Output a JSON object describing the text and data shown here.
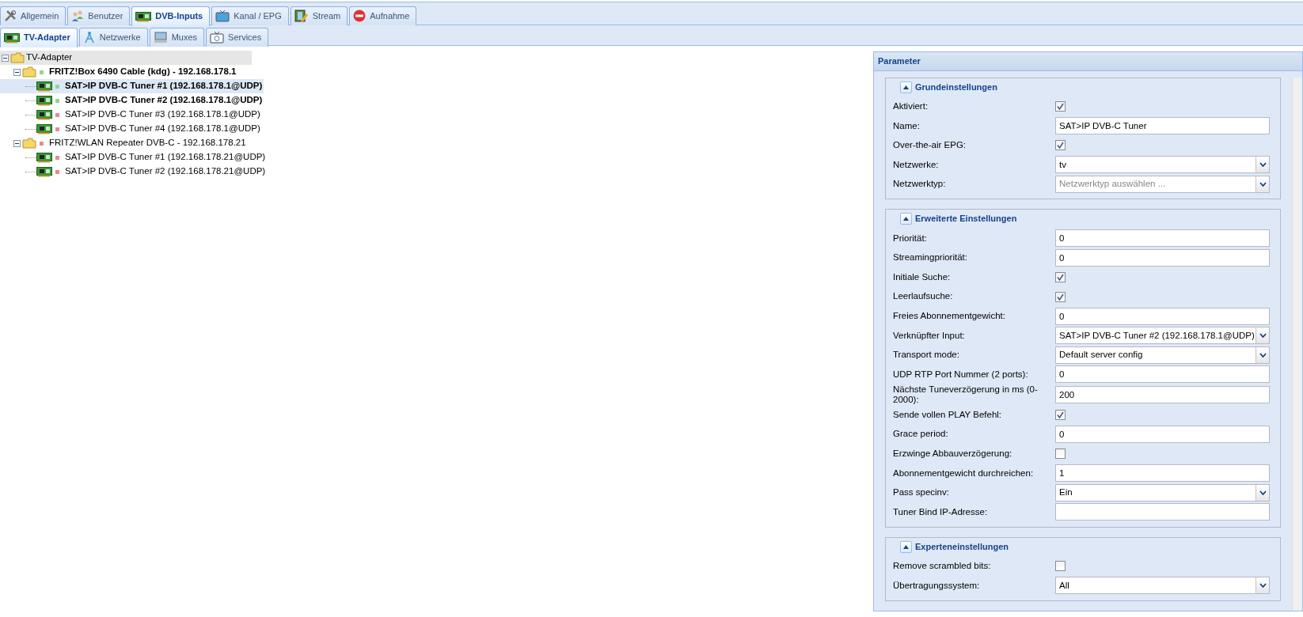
{
  "main_tabs": [
    {
      "label": "Allgemein",
      "selected": false
    },
    {
      "label": "Benutzer",
      "selected": false
    },
    {
      "label": "DVB-Inputs",
      "selected": true
    },
    {
      "label": "Kanal / EPG",
      "selected": false
    },
    {
      "label": "Stream",
      "selected": false
    },
    {
      "label": "Aufnahme",
      "selected": false
    }
  ],
  "sub_tabs": [
    {
      "label": "TV-Adapter",
      "selected": true
    },
    {
      "label": "Netzwerke",
      "selected": false
    },
    {
      "label": "Muxes",
      "selected": false
    },
    {
      "label": "Services",
      "selected": false
    }
  ],
  "tree": [
    {
      "label": "TV-Adapter",
      "kind": "folder",
      "expanded": true,
      "children": [
        {
          "label": "FRITZ!Box 6490 Cable (kdg) - 192.168.178.1",
          "kind": "folder",
          "expanded": true,
          "enabled": true,
          "color": "#8fd88f",
          "children": [
            {
              "label": "SAT>IP DVB-C Tuner #1 (192.168.178.1@UDP)",
              "kind": "tuner",
              "enabled": true,
              "color": "#8fd88f",
              "selected": true
            },
            {
              "label": "SAT>IP DVB-C Tuner #2 (192.168.178.1@UDP)",
              "kind": "tuner",
              "enabled": true,
              "color": "#8fd88f",
              "selected": false
            },
            {
              "label": "SAT>IP DVB-C Tuner #3 (192.168.178.1@UDP)",
              "kind": "tuner",
              "enabled": false,
              "color": "#e88a8a",
              "selected": false
            },
            {
              "label": "SAT>IP DVB-C Tuner #4 (192.168.178.1@UDP)",
              "kind": "tuner",
              "enabled": false,
              "color": "#e88a8a",
              "selected": false
            }
          ]
        },
        {
          "label": "FRITZ!WLAN Repeater DVB-C - 192.168.178.21",
          "kind": "folder",
          "expanded": true,
          "enabled": false,
          "color": "#e88a8a",
          "children": [
            {
              "label": "SAT>IP DVB-C Tuner #1 (192.168.178.21@UDP)",
              "kind": "tuner",
              "enabled": false,
              "color": "#e88a8a",
              "selected": false
            },
            {
              "label": "SAT>IP DVB-C Tuner #2 (192.168.178.21@UDP)",
              "kind": "tuner",
              "enabled": false,
              "color": "#e88a8a",
              "selected": false
            }
          ]
        }
      ]
    }
  ],
  "panel": {
    "title": "Parameter",
    "sections": [
      {
        "title": "Grundeinstellungen",
        "expanded": true,
        "fields": [
          {
            "label": "Aktiviert:",
            "kind": "checkbox",
            "checked": true
          },
          {
            "label": "Name:",
            "kind": "text",
            "value": "SAT>IP DVB-C Tuner"
          },
          {
            "label": "Over-the-air EPG:",
            "kind": "checkbox",
            "checked": true
          },
          {
            "label": "Netzwerke:",
            "kind": "select",
            "value": "tv"
          },
          {
            "label": "Netzwerktyp:",
            "kind": "select",
            "placeholder": "Netzwerktyp auswählen ..."
          }
        ]
      },
      {
        "title": "Erweiterte Einstellungen",
        "expanded": true,
        "fields": [
          {
            "label": "Priorität:",
            "kind": "text",
            "value": "0"
          },
          {
            "label": "Streamingpriorität:",
            "kind": "text",
            "value": "0"
          },
          {
            "label": "Initiale Suche:",
            "kind": "checkbox",
            "checked": true
          },
          {
            "label": "Leerlaufsuche:",
            "kind": "checkbox",
            "checked": true
          },
          {
            "label": "Freies Abonnementgewicht:",
            "kind": "text",
            "value": "0"
          },
          {
            "label": "Verknüpfter Input:",
            "kind": "select",
            "value": "SAT>IP DVB-C Tuner #2 (192.168.178.1@UDP)"
          },
          {
            "label": "Transport mode:",
            "kind": "select",
            "value": "Default server config"
          },
          {
            "label": "UDP RTP Port Nummer (2 ports):",
            "kind": "text",
            "value": "0"
          },
          {
            "label": "Nächste Tuneverzögerung in ms (0-2000):",
            "kind": "text",
            "value": "200"
          },
          {
            "label": "Sende vollen PLAY Befehl:",
            "kind": "checkbox",
            "checked": true
          },
          {
            "label": "Grace period:",
            "kind": "text",
            "value": "0"
          },
          {
            "label": "Erzwinge Abbauverzögerung:",
            "kind": "checkbox",
            "checked": false
          },
          {
            "label": "Abonnementgewicht durchreichen:",
            "kind": "text",
            "value": "1"
          },
          {
            "label": "Pass specinv:",
            "kind": "select",
            "value": "Ein"
          },
          {
            "label": "Tuner Bind IP-Adresse:",
            "kind": "text"
          }
        ]
      },
      {
        "title": "Experteneinstellungen",
        "expanded": true,
        "fields": [
          {
            "label": "Remove scrambled bits:",
            "kind": "checkbox",
            "checked": false
          },
          {
            "label": "Übertragungssystem:",
            "kind": "select",
            "value": "All"
          }
        ]
      }
    ]
  }
}
